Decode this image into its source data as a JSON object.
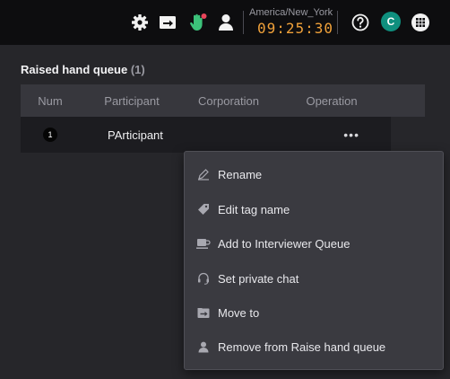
{
  "topbar": {
    "timezone": "America/New_York",
    "clock": "09:25:30",
    "avatar_initial": "C",
    "icons": [
      "gear-icon",
      "move-icon",
      "raised-hand-icon",
      "person-icon",
      "help-icon",
      "grid-icon"
    ],
    "notification_color": "#e8455a",
    "hand_color": "#3cc27a"
  },
  "panel": {
    "title": "Raised hand queue",
    "count": "(1)",
    "columns": [
      "Num",
      "Participant",
      "Corporation",
      "Operation"
    ],
    "rows": [
      {
        "num": "1",
        "participant": "PArticipant",
        "corporation": "",
        "operation": "•••"
      }
    ]
  },
  "menu": {
    "items": [
      {
        "label": "Rename",
        "icon": "pencil-icon"
      },
      {
        "label": "Edit tag name",
        "icon": "tag-icon"
      },
      {
        "label": "Add to Interviewer Queue",
        "icon": "cup-icon"
      },
      {
        "label": "Set private chat",
        "icon": "headset-icon"
      },
      {
        "label": "Move to",
        "icon": "move-icon"
      },
      {
        "label": "Remove from Raise hand queue",
        "icon": "person-icon"
      }
    ]
  },
  "colors": {
    "accent_avatar": "#0f8f7e",
    "clock": "#f0a13a"
  }
}
